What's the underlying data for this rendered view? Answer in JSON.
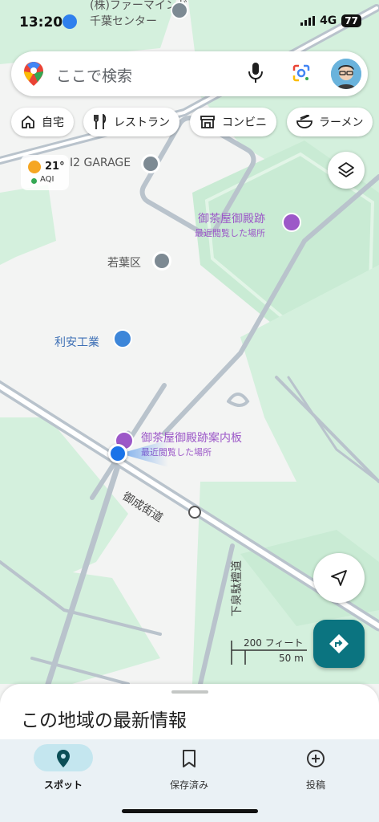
{
  "status": {
    "time": "13:20",
    "network": "4G",
    "battery": "77"
  },
  "search": {
    "placeholder": "ここで検索"
  },
  "chips": [
    {
      "label": "自宅",
      "icon": "home-icon"
    },
    {
      "label": "レストラン",
      "icon": "restaurant-icon"
    },
    {
      "label": "コンビニ",
      "icon": "store-icon"
    },
    {
      "label": "ラーメン",
      "icon": "ramen-icon"
    }
  ],
  "weather": {
    "temp": "21°",
    "aqi": "AQI"
  },
  "map": {
    "labels": {
      "farm_line1": "(株)ファーマインド",
      "farm_line2": "千葉センター",
      "garage": "I2 GARAGE",
      "ward": "若葉区",
      "company": "利安工業",
      "ruins": "御茶屋御殿跡",
      "ruins_sub": "最近閲覧した場所",
      "board": "御茶屋御殿跡案内板",
      "board_sub": "最近閲覧した場所",
      "road_main": "御成街道",
      "road_side": "下泉駄檀道"
    },
    "scale": {
      "imperial": "200 フィート",
      "metric": "50 m"
    }
  },
  "sheet": {
    "title": "この地域の最新情報"
  },
  "nav": [
    {
      "label": "スポット",
      "icon": "location-pin-icon",
      "active": true
    },
    {
      "label": "保存済み",
      "icon": "bookmark-icon",
      "active": false
    },
    {
      "label": "投稿",
      "icon": "add-circle-icon",
      "active": false
    }
  ],
  "colors": {
    "park": "#d4f0dd",
    "accent": "#0b7480",
    "place": "#9c58c8",
    "road": "#b9c3cc"
  }
}
